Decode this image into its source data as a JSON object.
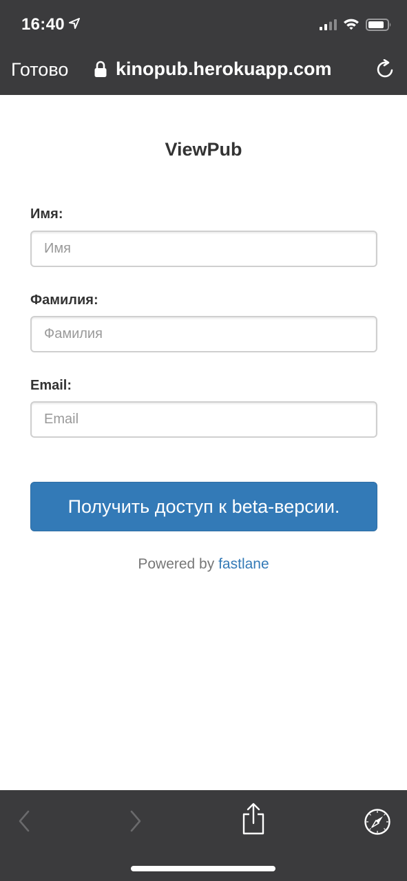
{
  "status_bar": {
    "time": "16:40"
  },
  "browser": {
    "done_label": "Готово",
    "url": "kinopub.herokuapp.com"
  },
  "form": {
    "title": "ViewPub",
    "fields": [
      {
        "label": "Имя:",
        "placeholder": "Имя"
      },
      {
        "label": "Фамилия:",
        "placeholder": "Фамилия"
      },
      {
        "label": "Email:",
        "placeholder": "Email"
      }
    ],
    "submit_label": "Получить доступ к beta-версии."
  },
  "footer": {
    "powered_prefix": "Powered by",
    "powered_link": "fastlane"
  },
  "colors": {
    "chrome_bg": "#3b3b3d",
    "primary": "#337ab7"
  },
  "icons": {
    "location": "location-arrow-icon",
    "signal": "cellular-signal-icon",
    "wifi": "wifi-icon",
    "battery": "battery-icon",
    "lock": "lock-icon",
    "reload": "reload-icon",
    "back": "back-arrow-icon",
    "forward": "forward-arrow-icon",
    "share": "share-icon",
    "compass": "compass-icon"
  }
}
